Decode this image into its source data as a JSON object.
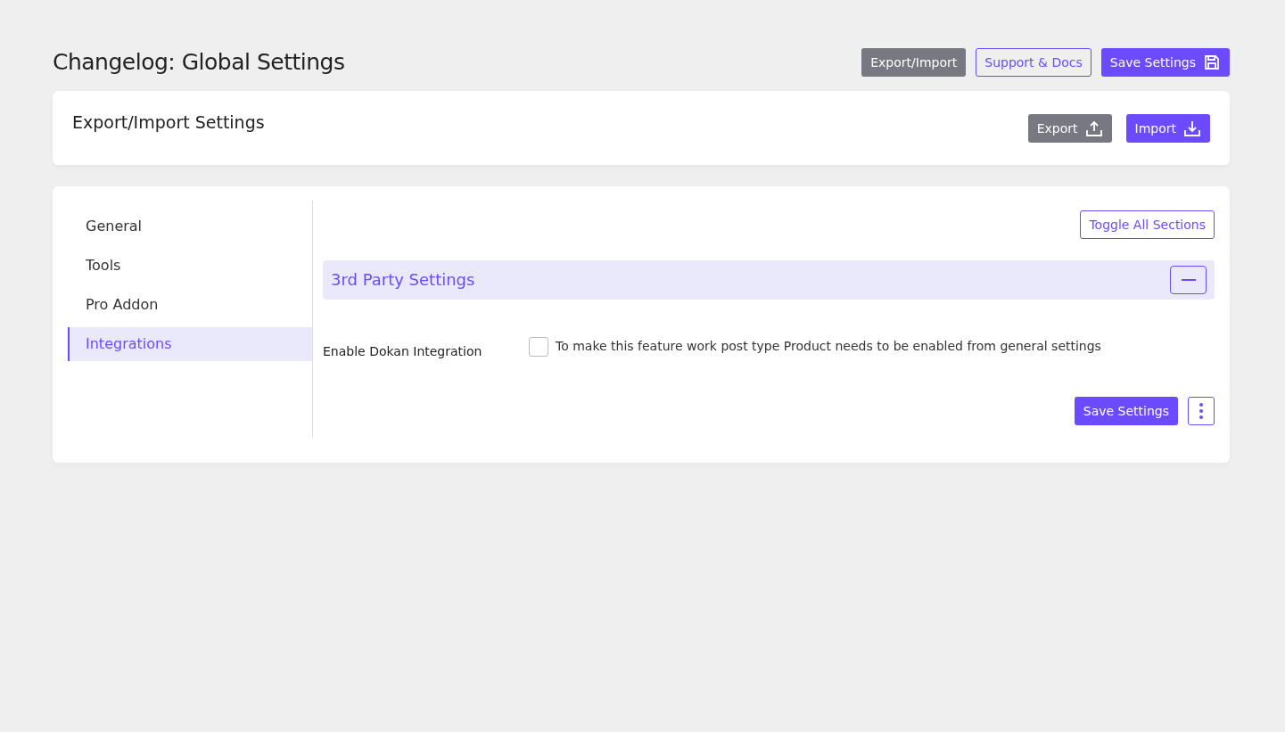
{
  "header": {
    "title": "Changelog: Global Settings",
    "buttons": [
      {
        "label": "Export/Import",
        "kind": "secondary"
      },
      {
        "label": "Support & Docs",
        "kind": "outline"
      },
      {
        "label": "Save Settings",
        "kind": "primary"
      }
    ]
  },
  "export_import": {
    "title": "Export/Import Settings",
    "buttons": [
      {
        "label": "Export",
        "kind": "secondary"
      },
      {
        "label": "Import",
        "kind": "primary"
      }
    ]
  },
  "sidebar": {
    "items": [
      {
        "label": "General",
        "selected": false
      },
      {
        "label": "Tools",
        "selected": false
      },
      {
        "label": "Pro Addon",
        "selected": false
      },
      {
        "label": "Integrations",
        "selected": true
      }
    ]
  },
  "toggle_button": "Toggle All Sections",
  "section": {
    "title": "3rd Party Settings",
    "expanded": true,
    "fields": [
      {
        "label": "Enable Dokan Integration",
        "checked": false,
        "description": "To make this feature work post type Product needs to be enabled from general settings"
      }
    ]
  },
  "footer": {
    "save_button": "Save Settings"
  }
}
